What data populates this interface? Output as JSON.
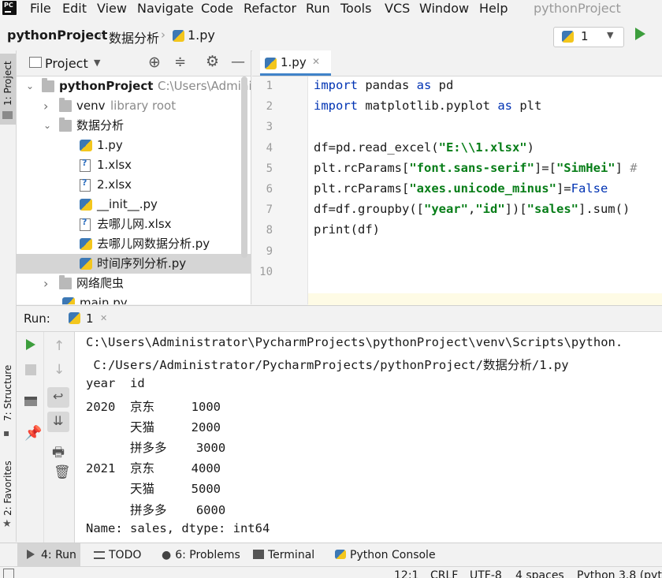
{
  "menu": {
    "items": [
      "File",
      "Edit",
      "View",
      "Navigate",
      "Code",
      "Refactor",
      "Run",
      "Tools",
      "VCS",
      "Window",
      "Help"
    ],
    "project_title": "pythonProject"
  },
  "navbar": {
    "breadcrumbs": [
      "pythonProject",
      "数据分析",
      "1.py"
    ],
    "run_config": "1"
  },
  "left_stripe": {
    "project_tab": "1: Project",
    "structure_tab": "7: Structure",
    "favorites_tab": "2: Favorites"
  },
  "project": {
    "header": "Project",
    "tree": [
      {
        "label": "pythonProject",
        "hint": "C:\\Users\\Administ",
        "type": "folder",
        "arrow": "v"
      },
      {
        "label": "venv",
        "hint": "library root",
        "type": "folder",
        "arrow": ">"
      },
      {
        "label": "数据分析",
        "hint": "",
        "type": "folder",
        "arrow": "v"
      },
      {
        "label": "1.py",
        "hint": "",
        "type": "py",
        "arrow": ""
      },
      {
        "label": "1.xlsx",
        "hint": "",
        "type": "xlsx",
        "arrow": ""
      },
      {
        "label": "2.xlsx",
        "hint": "",
        "type": "xlsx",
        "arrow": ""
      },
      {
        "label": "__init__.py",
        "hint": "",
        "type": "py",
        "arrow": ""
      },
      {
        "label": "去哪儿网.xlsx",
        "hint": "",
        "type": "xlsx",
        "arrow": ""
      },
      {
        "label": "去哪儿网数据分析.py",
        "hint": "",
        "type": "py",
        "arrow": ""
      },
      {
        "label": "时间序列分析.py",
        "hint": "",
        "type": "py",
        "arrow": ""
      },
      {
        "label": "网络爬虫",
        "hint": "",
        "type": "folder",
        "arrow": ">"
      },
      {
        "label": "main.py",
        "hint": "",
        "type": "py",
        "arrow": ""
      }
    ],
    "selected_index": 9
  },
  "editor": {
    "tab_label": "1.py",
    "line_numbers": [
      "1",
      "2",
      "3",
      "4",
      "5",
      "6",
      "7",
      "8",
      "9",
      "10"
    ],
    "lines": [
      "import pandas as pd",
      "import matplotlib.pyplot as plt",
      "",
      "df=pd.read_excel(\"E:\\\\1.xlsx\")",
      "plt.rcParams[\"font.sans-serif\"]=[\"SimHei\"] #",
      "plt.rcParams[\"axes.unicode_minus\"]=False",
      "df=df.groupby([\"year\",\"id\"])[\"sales\"].sum()",
      "print(df)",
      "",
      ""
    ]
  },
  "run": {
    "label": "Run:",
    "tab": "1",
    "console": [
      "C:\\Users\\Administrator\\PycharmProjects\\pythonProject\\venv\\Scripts\\python.",
      " C:/Users/Administrator/PycharmProjects/pythonProject/数据分析/1.py",
      "year  id",
      "2020  京东     1000",
      "      天猫     2000",
      "      拼多多    3000",
      "2021  京东     4000",
      "      天猫     5000",
      "      拼多多    6000",
      "Name: sales, dtype: int64"
    ]
  },
  "bottom_tabs": {
    "run": "4: Run",
    "todo": "TODO",
    "problems": "6: Problems",
    "terminal": "Terminal",
    "python_console": "Python Console"
  },
  "status": {
    "position": "12:1",
    "line_sep": "CRLF",
    "encoding": "UTF-8",
    "indent": "4 spaces",
    "interpreter": "Python 3.8 (pyt"
  },
  "colors": {
    "keyword": "#0033b3",
    "string": "#067d17",
    "run_green": "#3d9e3d",
    "tab_underline": "#4083c9"
  }
}
